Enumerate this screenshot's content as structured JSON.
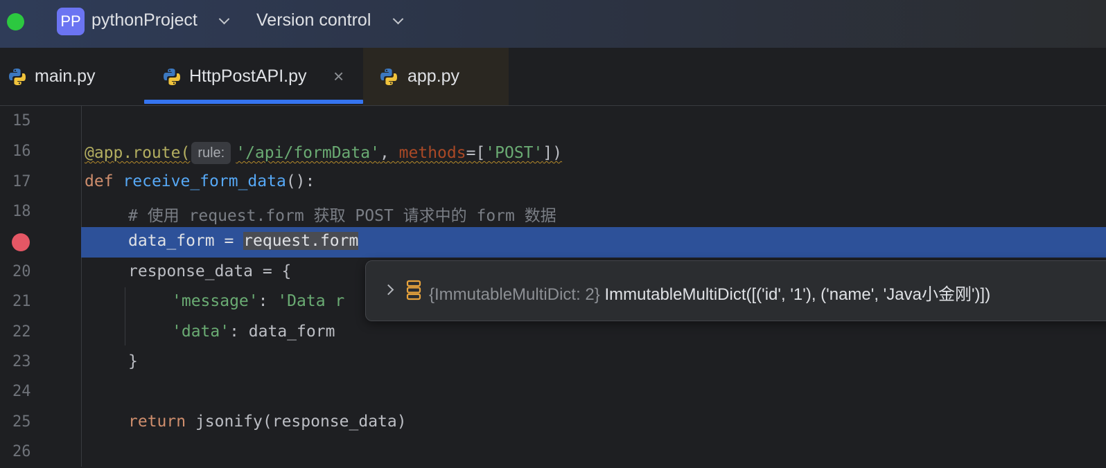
{
  "titlebar": {
    "project_initials": "PP",
    "project_name": "pythonProject",
    "version_control_label": "Version control"
  },
  "tabs": [
    {
      "label": "main.py",
      "active": false
    },
    {
      "label": "HttpPostAPI.py",
      "active": true,
      "close_glyph": "×"
    },
    {
      "label": "app.py",
      "active": false
    }
  ],
  "editor": {
    "line_numbers": [
      "15",
      "16",
      "17",
      "18",
      "19",
      "20",
      "21",
      "22",
      "23",
      "24",
      "25",
      "26"
    ],
    "breakpoint_line": "19",
    "code": {
      "l16": {
        "deco": "@app.route(",
        "hint": "rule:",
        "path": "'/api/formData'",
        "comma": ", ",
        "param": "methods",
        "eq": "=[",
        "method": "'POST'",
        "close": "])"
      },
      "l17": {
        "kw": "def",
        "fn": "receive_form_data",
        "rest": "():"
      },
      "l18": {
        "comment": "# 使用 request.form 获取 POST 请求中的 form 数据"
      },
      "l19": {
        "lhs": "data_form = ",
        "expr": "request.form"
      },
      "l20": {
        "text": "response_data = {"
      },
      "l21": {
        "key": "'message'",
        "sep": ": ",
        "val": "'Data r"
      },
      "l22": {
        "key": "'data'",
        "sep": ": ",
        "val": "data_form"
      },
      "l23": {
        "text": "}"
      },
      "l25": {
        "kw": "return",
        "rest": " jsonify(response_data)"
      }
    }
  },
  "debug_popup": {
    "type_hint": "{ImmutableMultiDict: 2}",
    "value": "ImmutableMultiDict([('id', '1'), ('name', 'Java小金刚')])"
  },
  "colors": {
    "accent": "#3574f0",
    "breakpoint": "#e55765",
    "project_badge": "#6b74f2",
    "traffic_green": "#2cc840"
  }
}
